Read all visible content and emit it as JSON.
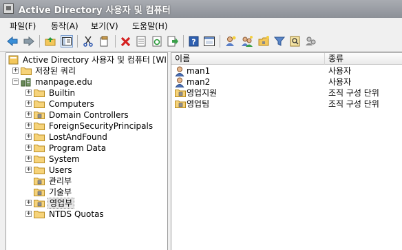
{
  "window": {
    "title": "Active Directory 사용자 및 컴퓨터"
  },
  "menu": {
    "file": "파일(F)",
    "action": "동작(A)",
    "view": "보기(V)",
    "help": "도움말(H)"
  },
  "toolbar": {
    "icons": [
      "back-arrow-icon",
      "forward-arrow-icon",
      "up-folder-icon",
      "show-hide-tree-icon",
      "cut-icon",
      "copy-icon",
      "delete-icon",
      "properties-icon",
      "refresh-icon",
      "export-list-icon",
      "help-icon",
      "console-view-icon",
      "new-user-icon",
      "new-group-icon",
      "new-ou-icon",
      "filter-icon",
      "find-icon",
      "users-group-icon"
    ]
  },
  "tree": {
    "root_label": "Active Directory 사용자 및 컴퓨터 [WI",
    "saved_queries": "저장된 쿼리",
    "domain": "manpage.edu",
    "items": [
      {
        "label": "Builtin",
        "expandable": true,
        "ou": false
      },
      {
        "label": "Computers",
        "expandable": true,
        "ou": false
      },
      {
        "label": "Domain Controllers",
        "expandable": true,
        "ou": true
      },
      {
        "label": "ForeignSecurityPrincipals",
        "expandable": true,
        "ou": false
      },
      {
        "label": "LostAndFound",
        "expandable": true,
        "ou": false
      },
      {
        "label": "Program Data",
        "expandable": true,
        "ou": false
      },
      {
        "label": "System",
        "expandable": true,
        "ou": false
      },
      {
        "label": "Users",
        "expandable": true,
        "ou": false
      },
      {
        "label": "관리부",
        "expandable": false,
        "ou": true
      },
      {
        "label": "기술부",
        "expandable": false,
        "ou": true
      },
      {
        "label": "영업부",
        "expandable": true,
        "ou": true,
        "selected": true
      },
      {
        "label": "NTDS Quotas",
        "expandable": true,
        "ou": false
      }
    ]
  },
  "list": {
    "columns": [
      "이름",
      "종류"
    ],
    "rows": [
      {
        "name": "man1",
        "type": "사용자",
        "icon": "user-icon"
      },
      {
        "name": "man2",
        "type": "사용자",
        "icon": "user-icon"
      },
      {
        "name": "영업지원",
        "type": "조직 구성 단위",
        "icon": "ou-folder-icon"
      },
      {
        "name": "영업팀",
        "type": "조직 구성 단위",
        "icon": "ou-folder-icon"
      }
    ]
  }
}
